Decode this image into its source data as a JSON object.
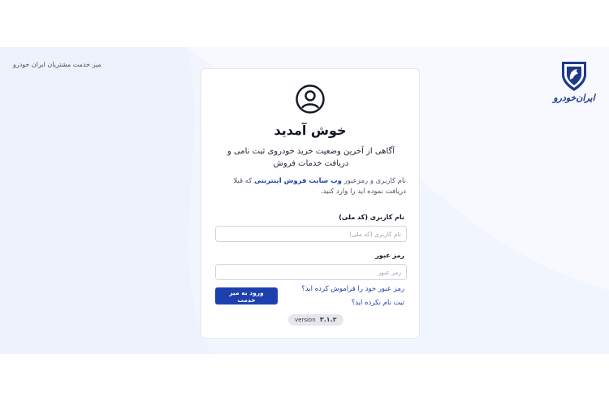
{
  "header": {
    "title": "میز خدمت مشتریان ایران خودرو",
    "logo_text": "ایران‌خودرو",
    "brand_color": "#1e40af"
  },
  "card": {
    "welcome": "خوش آمدید",
    "subtitle": "آگاهی از آخرین وضعیت خرید خودروی ثبت نامی و دریافت خدمات فروش",
    "desc_before": "نام کاربری و رمزعبور ",
    "desc_link": "وب سایت فروش اینترنتی",
    "desc_after": " که قبلا دریافت نموده اید را وارد کنید.",
    "username_label": "نام کاربری (کد ملی)",
    "username_placeholder": "نام کاربری (کد ملی)",
    "username_value": "",
    "password_label": "رمز عبور",
    "password_placeholder": "رمز عبور",
    "password_value": "",
    "forgot_link": "رمز عبور خود را فراموش کرده اید؟",
    "register_link": "ثبت نام نکرده اید؟",
    "login_button": "ورود به میز خدمت",
    "version_label": "version",
    "version_number": "۳.۱.۲"
  },
  "icons": {
    "user": "user-circle-icon",
    "logo": "horse-shield-logo"
  }
}
